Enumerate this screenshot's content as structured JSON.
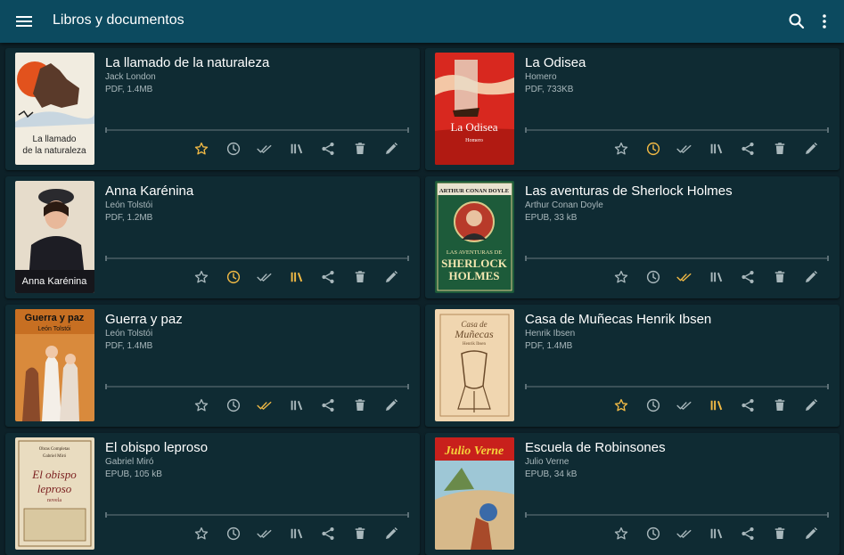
{
  "app": {
    "title": "Libros y documentos",
    "icons": {
      "menu": "menu-icon",
      "search": "search-icon",
      "more": "more-vert-icon"
    }
  },
  "colors": {
    "appbar": "#0c4a5f",
    "background": "#0d2128",
    "card": "#0f2b33",
    "icon_default": "#a9b8bc",
    "icon_active": "#f0b945"
  },
  "actions": [
    "favorite",
    "recent",
    "read",
    "collection",
    "share",
    "delete",
    "edit"
  ],
  "books": [
    {
      "title": "La llamado de la naturaleza",
      "author": "Jack London",
      "meta": "PDF, 1.4MB",
      "cover_text": [
        "La llamado",
        "de la naturaleza"
      ],
      "active": {
        "favorite": true,
        "recent": false,
        "read": false,
        "collection": false
      }
    },
    {
      "title": "La Odisea",
      "author": "Homero",
      "meta": "PDF, 733KB",
      "cover_text": [
        "La Odisea",
        "Homero"
      ],
      "active": {
        "favorite": false,
        "recent": true,
        "read": false,
        "collection": false
      }
    },
    {
      "title": "Anna Karénina",
      "author": "León Tolstói",
      "meta": "PDF, 1.2MB",
      "cover_text": [
        "Anna Karénina"
      ],
      "active": {
        "favorite": false,
        "recent": true,
        "read": false,
        "collection": true
      }
    },
    {
      "title": "Las aventuras de Sherlock Holmes",
      "author": "Arthur Conan Doyle",
      "meta": "EPUB, 33 kB",
      "cover_text": [
        "ARTHUR CONAN DOYLE",
        "LAS AVENTURAS DE",
        "SHERLOCK",
        "HOLMES"
      ],
      "active": {
        "favorite": false,
        "recent": false,
        "read": true,
        "collection": false
      }
    },
    {
      "title": "Guerra y paz",
      "author": "León Tolstói",
      "meta": "PDF, 1.4MB",
      "cover_text": [
        "Guerra y paz",
        "León Tolstói"
      ],
      "active": {
        "favorite": false,
        "recent": false,
        "read": true,
        "collection": false
      }
    },
    {
      "title": "Casa de Muñecas Henrik Ibsen",
      "author": "Henrik Ibsen",
      "meta": "PDF, 1.4MB",
      "cover_text": [
        "Casa de",
        "Muñecas",
        "Henrik Ibsen"
      ],
      "active": {
        "favorite": true,
        "recent": false,
        "read": false,
        "collection": true
      }
    },
    {
      "title": "El obispo leproso",
      "author": "Gabriel Miró",
      "meta": "EPUB, 105 kB",
      "cover_text": [
        "Obras Completas",
        "Gabriel Miró",
        "El obispo",
        "leproso",
        "novela"
      ],
      "active": {
        "favorite": false,
        "recent": false,
        "read": false,
        "collection": false
      }
    },
    {
      "title": "Escuela de Robinsones",
      "author": "Julio Verne",
      "meta": "EPUB, 34 kB",
      "cover_text": [
        "Julio Verne"
      ],
      "active": {
        "favorite": false,
        "recent": false,
        "read": false,
        "collection": false
      }
    }
  ]
}
